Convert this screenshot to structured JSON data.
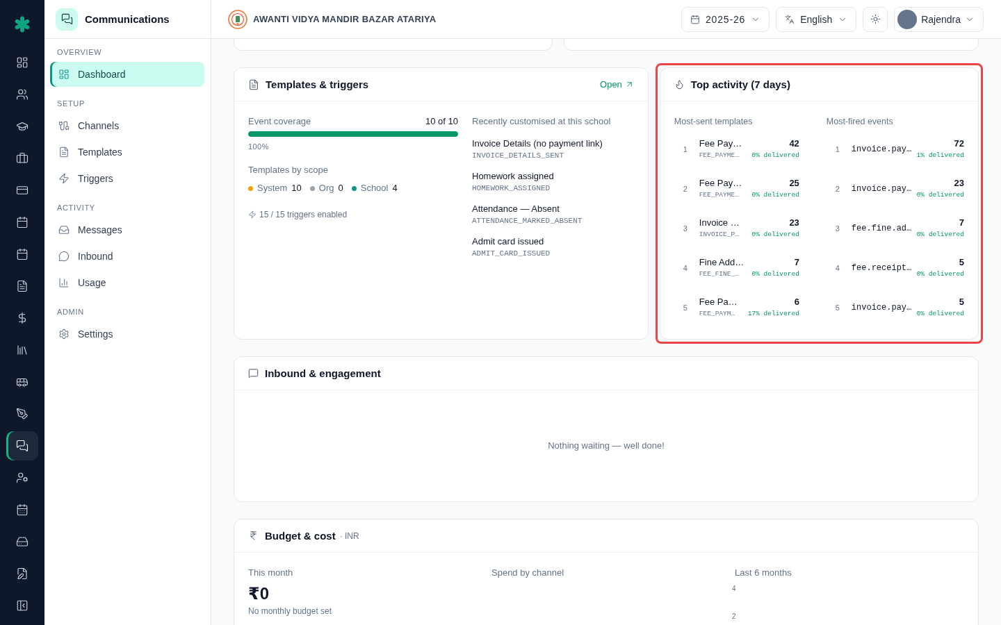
{
  "rail": {
    "items": [
      {
        "selected": false
      },
      {
        "selected": false
      },
      {
        "selected": false
      },
      {
        "selected": false
      },
      {
        "selected": false
      },
      {
        "selected": false
      },
      {
        "selected": false
      },
      {
        "selected": false
      },
      {
        "selected": false
      },
      {
        "selected": false
      },
      {
        "selected": false
      },
      {
        "selected": false
      },
      {
        "selected": true
      },
      {
        "selected": false
      },
      {
        "selected": false
      },
      {
        "selected": false
      },
      {
        "selected": false
      }
    ]
  },
  "sidebar": {
    "title": "Communications",
    "sections": [
      {
        "heading": "OVERVIEW",
        "items": [
          {
            "label": "Dashboard",
            "selected": true
          }
        ]
      },
      {
        "heading": "SETUP",
        "items": [
          {
            "label": "Channels",
            "selected": false
          },
          {
            "label": "Templates",
            "selected": false
          },
          {
            "label": "Triggers",
            "selected": false
          }
        ]
      },
      {
        "heading": "ACTIVITY",
        "items": [
          {
            "label": "Messages",
            "selected": false
          },
          {
            "label": "Inbound",
            "selected": false
          },
          {
            "label": "Usage",
            "selected": false
          }
        ]
      },
      {
        "heading": "ADMIN",
        "items": [
          {
            "label": "Settings",
            "selected": false
          }
        ]
      }
    ]
  },
  "header": {
    "school_name": "AWANTI VIDYA MANDIR BAZAR ATARIYA",
    "year": "2025-26",
    "language": "English",
    "user": "Rajendra"
  },
  "templates_triggers": {
    "title": "Templates & triggers",
    "open_link": "Open",
    "coverage": {
      "label": "Event coverage",
      "count": "10 of 10",
      "level": 1,
      "percent": "100%"
    },
    "scope": {
      "label": "Templates by scope",
      "items": [
        {
          "name": "System",
          "count": "10",
          "color": "#f59e0b"
        },
        {
          "name": "Org",
          "count": "0",
          "color": "#9ca3af"
        },
        {
          "name": "School",
          "count": "4",
          "color": "#0d9488"
        }
      ]
    },
    "triggers_enabled": "15 / 15 triggers enabled",
    "recent": {
      "label": "Recently customised at this school",
      "items": [
        {
          "name": "Invoice Details (no payment link)",
          "code": "INVOICE_DETAILS_SENT"
        },
        {
          "name": "Homework assigned",
          "code": "HOMEWORK_ASSIGNED"
        },
        {
          "name": "Attendance — Absent",
          "code": "ATTENDANCE_MARKED_ABSENT"
        },
        {
          "name": "Admit card issued",
          "code": "ADMIT_CARD_ISSUED"
        }
      ]
    }
  },
  "top_activity": {
    "title": "Top activity (7 days)",
    "highlighted": true,
    "templates": {
      "label": "Most-sent templates",
      "items": [
        {
          "rank": "1",
          "name": "Fee Pay…",
          "code": "FEE_PAYME…",
          "count": "42",
          "delivered": "0% delivered"
        },
        {
          "rank": "2",
          "name": "Fee Pay…",
          "code": "FEE_PAYME…",
          "count": "25",
          "delivered": "0% delivered"
        },
        {
          "rank": "3",
          "name": "Invoice …",
          "code": "INVOICE_P…",
          "count": "23",
          "delivered": "0% delivered"
        },
        {
          "rank": "4",
          "name": "Fine Add…",
          "code": "FEE_FINE_…",
          "count": "7",
          "delivered": "0% delivered"
        },
        {
          "rank": "5",
          "name": "Fee Pa…",
          "code": "FEE_PAYM…",
          "count": "6",
          "delivered": "17% delivered"
        }
      ]
    },
    "events": {
      "label": "Most-fired events",
      "items": [
        {
          "rank": "1",
          "name": "invoice.pay…",
          "count": "72",
          "delivered": "1% delivered"
        },
        {
          "rank": "2",
          "name": "invoice.pay…",
          "count": "23",
          "delivered": "0% delivered"
        },
        {
          "rank": "3",
          "name": "fee.fine.ad…",
          "count": "7",
          "delivered": "0% delivered"
        },
        {
          "rank": "4",
          "name": "fee.receipt…",
          "count": "5",
          "delivered": "0% delivered"
        },
        {
          "rank": "5",
          "name": "invoice.pay…",
          "count": "5",
          "delivered": "0% delivered"
        }
      ]
    }
  },
  "inbound": {
    "title": "Inbound & engagement",
    "empty_message": "Nothing waiting — well done!"
  },
  "budget": {
    "title": "Budget & cost",
    "currency": "· INR",
    "this_month": {
      "label": "This month",
      "amount": "₹0",
      "note": "No monthly budget set"
    },
    "spend_by_channel": {
      "label": "Spend by channel"
    },
    "last_6_months": {
      "label": "Last 6 months",
      "axis_ticks": [
        "4",
        "2"
      ]
    }
  }
}
